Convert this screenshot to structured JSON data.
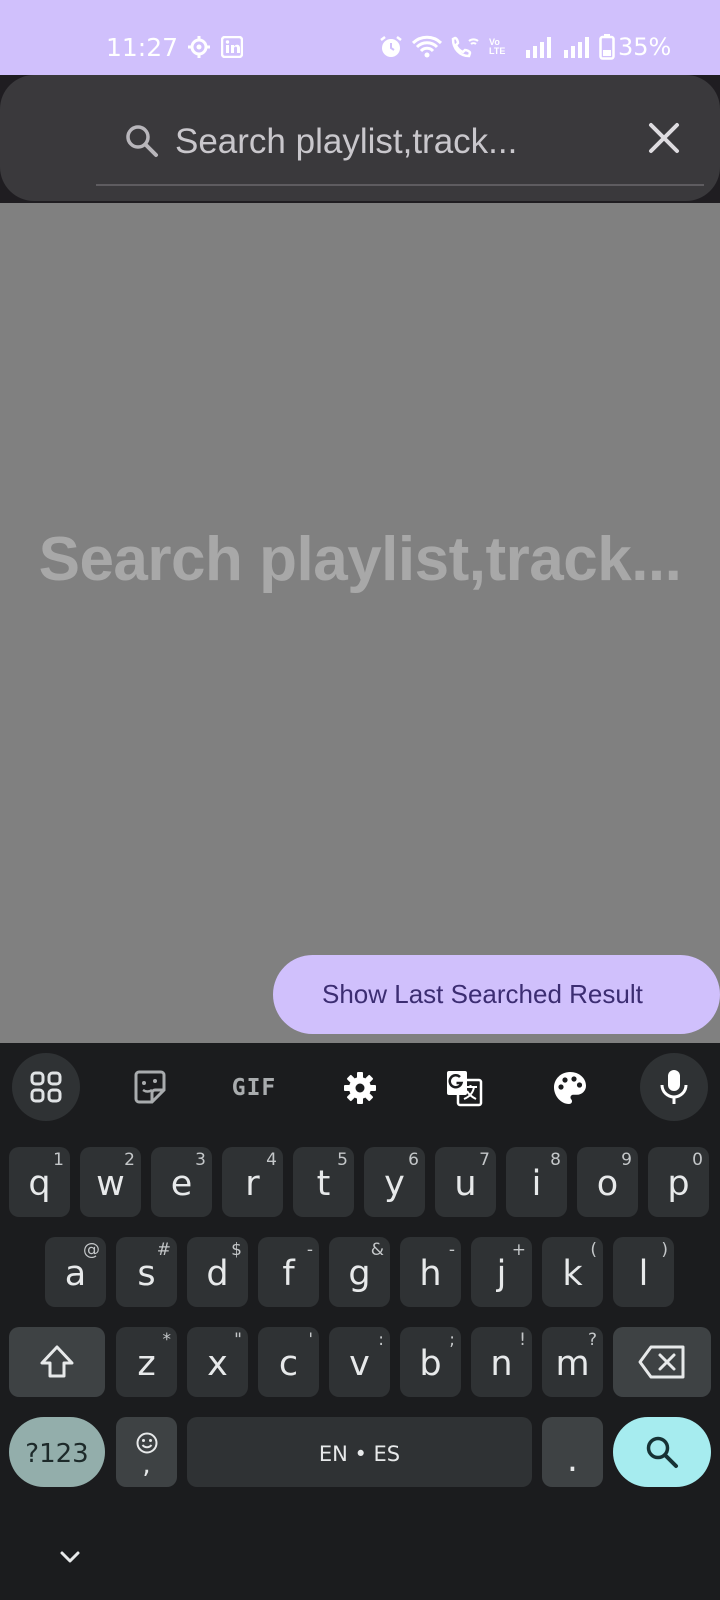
{
  "status_bar": {
    "time": "11:27",
    "battery": "35%",
    "icons": [
      "gear-icon",
      "linkedin-icon",
      "alarm-icon",
      "wifi-icon",
      "wifi-call-icon",
      "volte-icon",
      "signal-icon",
      "signal-icon",
      "battery-icon"
    ],
    "volte_label": "Vo LTE",
    "bg_color": "#d0c0fc"
  },
  "search": {
    "placeholder": "Search playlist,track...",
    "value": ""
  },
  "main": {
    "empty_hint": "Search playlist,track...",
    "last_searched_button": "Show Last Searched Result"
  },
  "keyboard": {
    "toolbar": {
      "items": [
        "apps-grid-icon",
        "sticker-icon",
        "gif-icon",
        "settings-icon",
        "translate-icon",
        "palette-icon",
        "microphone-icon"
      ],
      "gif_label": "GIF"
    },
    "row1": [
      {
        "key": "q",
        "hint": "1"
      },
      {
        "key": "w",
        "hint": "2"
      },
      {
        "key": "e",
        "hint": "3"
      },
      {
        "key": "r",
        "hint": "4"
      },
      {
        "key": "t",
        "hint": "5"
      },
      {
        "key": "y",
        "hint": "6"
      },
      {
        "key": "u",
        "hint": "7"
      },
      {
        "key": "i",
        "hint": "8"
      },
      {
        "key": "o",
        "hint": "9"
      },
      {
        "key": "p",
        "hint": "0"
      }
    ],
    "row2": [
      {
        "key": "a",
        "hint": "@"
      },
      {
        "key": "s",
        "hint": "#"
      },
      {
        "key": "d",
        "hint": "$"
      },
      {
        "key": "f",
        "hint": "-"
      },
      {
        "key": "g",
        "hint": "&"
      },
      {
        "key": "h",
        "hint": "-"
      },
      {
        "key": "j",
        "hint": "+"
      },
      {
        "key": "k",
        "hint": "("
      },
      {
        "key": "l",
        "hint": ")"
      }
    ],
    "row3": [
      {
        "key": "z",
        "hint": "*"
      },
      {
        "key": "x",
        "hint": "\""
      },
      {
        "key": "c",
        "hint": "'"
      },
      {
        "key": "v",
        "hint": ":"
      },
      {
        "key": "b",
        "hint": ";"
      },
      {
        "key": "n",
        "hint": "!"
      },
      {
        "key": "m",
        "hint": "?"
      }
    ],
    "bottom": {
      "symbols": "?123",
      "comma": ",",
      "space": "EN • ES",
      "period": "."
    },
    "colors": {
      "symbols_key": "#93aeab",
      "search_key": "#a6ecef"
    }
  }
}
